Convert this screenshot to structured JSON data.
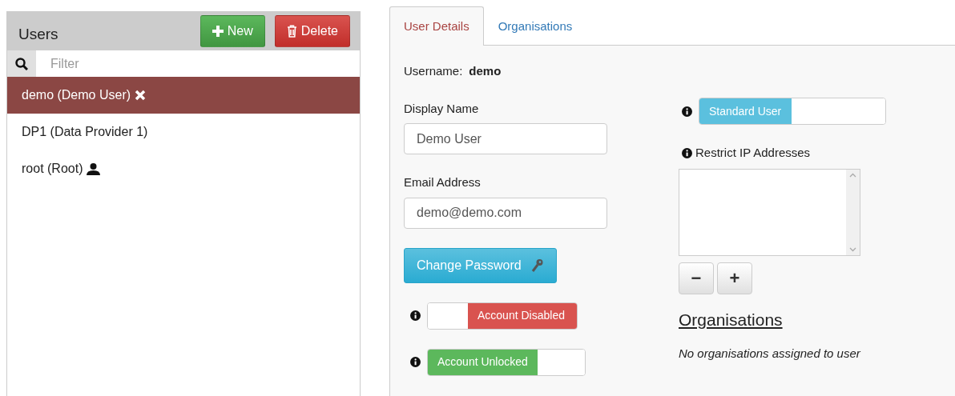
{
  "users_panel": {
    "title": "Users",
    "new_button": "New",
    "delete_button": "Delete",
    "filter": {
      "placeholder": "Filter"
    },
    "items": [
      {
        "label": "demo (Demo User)",
        "kind": "remove",
        "selected": true
      },
      {
        "label": "DP1 (Data Provider 1)",
        "kind": "plain",
        "selected": false
      },
      {
        "label": "root (Root)",
        "kind": "admin",
        "selected": false
      }
    ]
  },
  "tabs": [
    {
      "label": "User Details",
      "selected": true
    },
    {
      "label": "Organisations",
      "selected": false
    }
  ],
  "details": {
    "username_label": "Username:",
    "username": "demo",
    "display_name": {
      "label": "Display Name",
      "value": "Demo User"
    },
    "email": {
      "label": "Email Address",
      "value": "demo@demo.com"
    },
    "change_password": "Change Password",
    "toggles": [
      {
        "label": "Account Disabled",
        "on": false,
        "color": "#d9534f"
      },
      {
        "label": "Account Unlocked",
        "on": true,
        "color": "#5cb85c"
      }
    ],
    "role_toggle": {
      "label": "Standard User",
      "on": true,
      "color": "#5bc0de"
    },
    "restrict_ip_label": "Restrict IP Addresses",
    "ip_buttons": [
      "−",
      "+"
    ],
    "organisations_heading": "Organisations",
    "organisations_empty": "No organisations assigned to user"
  }
}
